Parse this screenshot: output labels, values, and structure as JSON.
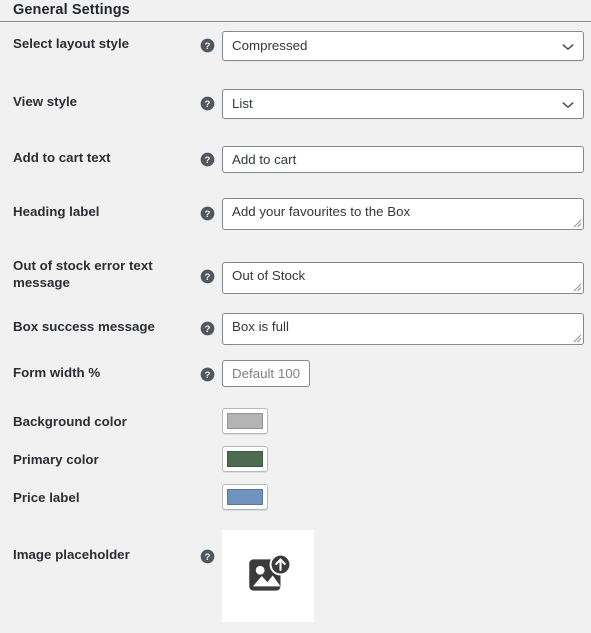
{
  "panel": {
    "title": "General Settings"
  },
  "icons": {
    "help": "help-icon",
    "chevron_down": "chevron-down-icon",
    "resize": "resize-handle-icon",
    "image_upload": "image-upload-icon"
  },
  "colors": {
    "page_background": "#f1f1f1",
    "field_border": "#7e8993",
    "text": "#23282d",
    "background_color_value": "#b4b4b4",
    "primary_color_value": "#4c6b4f",
    "price_label_value": "#6e93bd"
  },
  "rows": [
    {
      "label": "Select layout style",
      "has_help": true,
      "control": "select",
      "value": "Compressed",
      "options": [
        "Compressed"
      ]
    },
    {
      "label": "View style",
      "has_help": true,
      "control": "select",
      "value": "List",
      "options": [
        "List"
      ]
    },
    {
      "label": "Add to cart text",
      "has_help": true,
      "control": "text",
      "value": "Add to cart",
      "placeholder": ""
    },
    {
      "label": "Heading label",
      "has_help": true,
      "control": "textarea",
      "value": "Add your favourites to the Box",
      "placeholder": ""
    },
    {
      "label": "Out of stock error text message",
      "has_help": true,
      "control": "textarea",
      "value": "Out of Stock",
      "placeholder": ""
    },
    {
      "label": "Box success message",
      "has_help": true,
      "control": "textarea",
      "value": "Box is full",
      "placeholder": ""
    },
    {
      "label": "Form width %",
      "has_help": true,
      "control": "text-narrow",
      "value": "",
      "placeholder": "Default 100"
    },
    {
      "label": "Background color",
      "has_help": false,
      "control": "color",
      "value": "#b4b4b4"
    },
    {
      "label": "Primary color",
      "has_help": false,
      "control": "color",
      "value": "#4c6b4f"
    },
    {
      "label": "Price label",
      "has_help": false,
      "control": "color",
      "value": "#6e93bd"
    },
    {
      "label": "Image placeholder",
      "has_help": true,
      "control": "image",
      "value": ""
    }
  ]
}
